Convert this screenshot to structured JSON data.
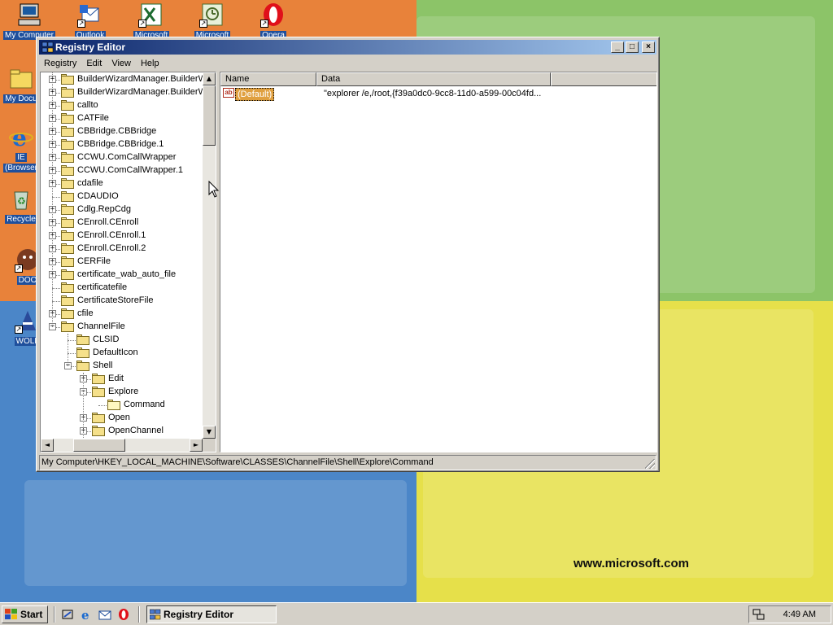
{
  "colors": {
    "titlebar_start": "#0a246a",
    "titlebar_end": "#a6caf0",
    "face": "#d4d0c8",
    "selection": "#e0a040",
    "desktop_label_bg": "#1f4f9c"
  },
  "desktop": {
    "watermark": "www.microsoft.com",
    "top_icons": [
      {
        "label": "My Computer",
        "icon": "computer-icon"
      },
      {
        "label": "Outlook",
        "icon": "outlook-icon"
      },
      {
        "label": "Microsoft",
        "icon": "excel-icon"
      },
      {
        "label": "Microsoft",
        "icon": "project-icon"
      },
      {
        "label": "Opera",
        "icon": "opera-icon"
      }
    ],
    "left_icons": [
      {
        "label": "My Docu",
        "icon": "folder-icon"
      },
      {
        "label": "IE",
        "label2": "(Browser",
        "icon": "ie-icon"
      },
      {
        "label": "Recycle",
        "icon": "recycle-bin-icon"
      },
      {
        "label": "DOO",
        "icon": "doom-icon"
      },
      {
        "label": "WOLF",
        "icon": "wolf-icon"
      }
    ]
  },
  "window": {
    "title": "Registry Editor",
    "menu": [
      "Registry",
      "Edit",
      "View",
      "Help"
    ],
    "tree_items": [
      {
        "label": "BuilderWizardManager.BuilderW",
        "depth": 0,
        "expander": "+"
      },
      {
        "label": "BuilderWizardManager.BuilderW",
        "depth": 0,
        "expander": "+"
      },
      {
        "label": "callto",
        "depth": 0,
        "expander": "+"
      },
      {
        "label": "CATFile",
        "depth": 0,
        "expander": "+"
      },
      {
        "label": "CBBridge.CBBridge",
        "depth": 0,
        "expander": "+"
      },
      {
        "label": "CBBridge.CBBridge.1",
        "depth": 0,
        "expander": "+"
      },
      {
        "label": "CCWU.ComCallWrapper",
        "depth": 0,
        "expander": "+"
      },
      {
        "label": "CCWU.ComCallWrapper.1",
        "depth": 0,
        "expander": "+"
      },
      {
        "label": "cdafile",
        "depth": 0,
        "expander": "+"
      },
      {
        "label": "CDAUDIO",
        "depth": 0,
        "expander": ""
      },
      {
        "label": "Cdlg.RepCdg",
        "depth": 0,
        "expander": "+"
      },
      {
        "label": "CEnroll.CEnroll",
        "depth": 0,
        "expander": "+"
      },
      {
        "label": "CEnroll.CEnroll.1",
        "depth": 0,
        "expander": "+"
      },
      {
        "label": "CEnroll.CEnroll.2",
        "depth": 0,
        "expander": "+"
      },
      {
        "label": "CERFile",
        "depth": 0,
        "expander": "+"
      },
      {
        "label": "certificate_wab_auto_file",
        "depth": 0,
        "expander": "+"
      },
      {
        "label": "certificatefile",
        "depth": 0,
        "expander": ""
      },
      {
        "label": "CertificateStoreFile",
        "depth": 0,
        "expander": ""
      },
      {
        "label": "cfile",
        "depth": 0,
        "expander": "+"
      },
      {
        "label": "ChannelFile",
        "depth": 0,
        "expander": "-"
      },
      {
        "label": "CLSID",
        "depth": 1,
        "expander": ""
      },
      {
        "label": "DefaultIcon",
        "depth": 1,
        "expander": ""
      },
      {
        "label": "Shell",
        "depth": 1,
        "expander": "-"
      },
      {
        "label": "Edit",
        "depth": 2,
        "expander": "+"
      },
      {
        "label": "Explore",
        "depth": 2,
        "expander": "-"
      },
      {
        "label": "Command",
        "depth": 3,
        "expander": "",
        "open": true
      },
      {
        "label": "Open",
        "depth": 2,
        "expander": "+"
      },
      {
        "label": "OpenChannel",
        "depth": 2,
        "expander": "+"
      }
    ],
    "columns": {
      "name": "Name",
      "data": "Data"
    },
    "values": [
      {
        "name": "(Default)",
        "data": "\"explorer /e,/root,{f39a0dc0-9cc8-11d0-a599-00c04fd...",
        "type_glyph": "ab"
      }
    ],
    "status": "My Computer\\HKEY_LOCAL_MACHINE\\Software\\CLASSES\\ChannelFile\\Shell\\Explore\\Command"
  },
  "taskbar": {
    "start_label": "Start",
    "quick_launch": [
      "show-desktop-icon",
      "ie-icon",
      "outlook-icon",
      "opera-icon"
    ],
    "task_label": "Registry Editor",
    "clock": "4:49 AM"
  }
}
